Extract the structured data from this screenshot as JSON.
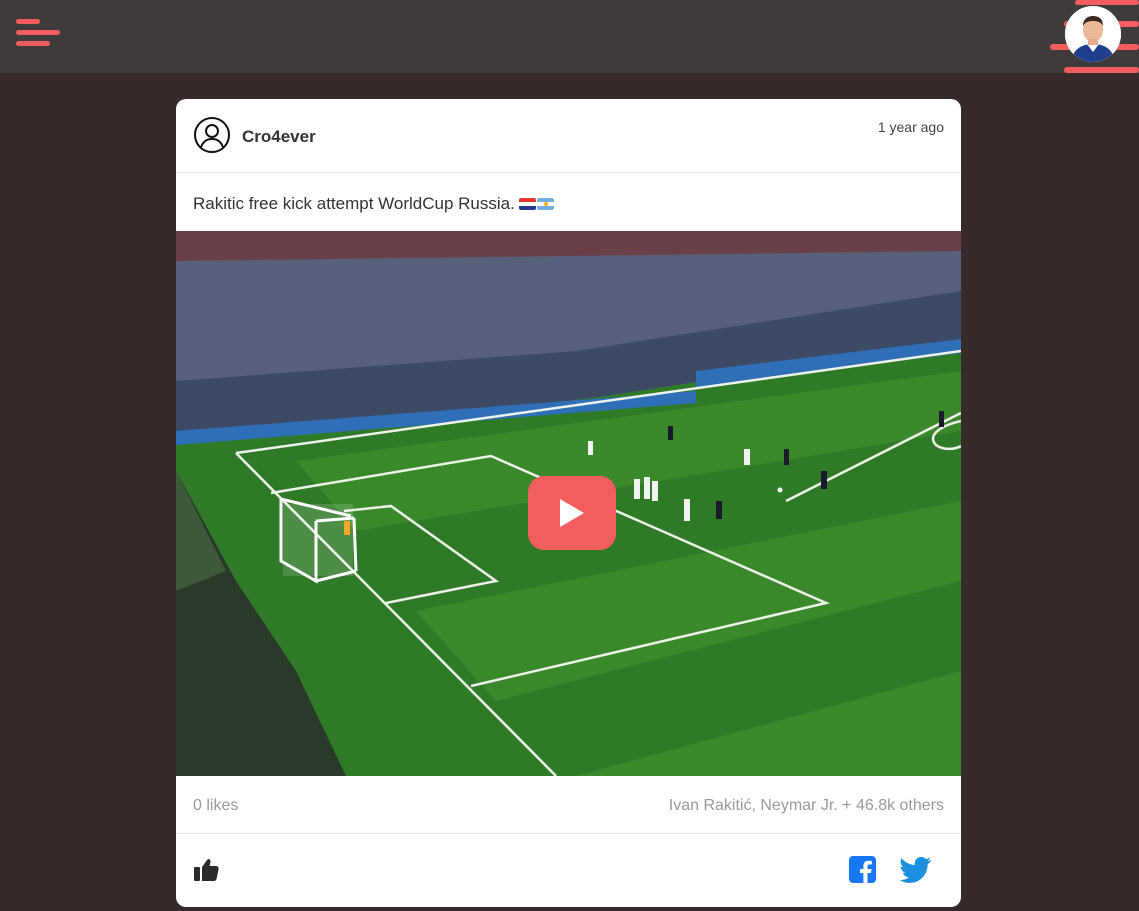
{
  "header": {
    "menu_icon": "hamburger-icon",
    "avatar_icon": "user-avatar",
    "accent_color": "#f25e5e"
  },
  "post": {
    "author": "Cro4ever",
    "author_icon": "user-circle-icon",
    "time": "1 year ago",
    "caption": "Rakitic free kick attempt WorldCup Russia.",
    "caption_flags": [
      "croatia-flag",
      "argentina-flag"
    ],
    "media_icon": "play-icon",
    "likes": "0 likes",
    "liked_by": "Ivan Rakitić, Neymar Jr. + 46.8k others"
  },
  "actions": {
    "like_icon": "thumbs-up-icon",
    "facebook_icon": "facebook-icon",
    "twitter_icon": "twitter-icon",
    "facebook_color": "#1877f2",
    "twitter_color": "#1d8fe0"
  }
}
